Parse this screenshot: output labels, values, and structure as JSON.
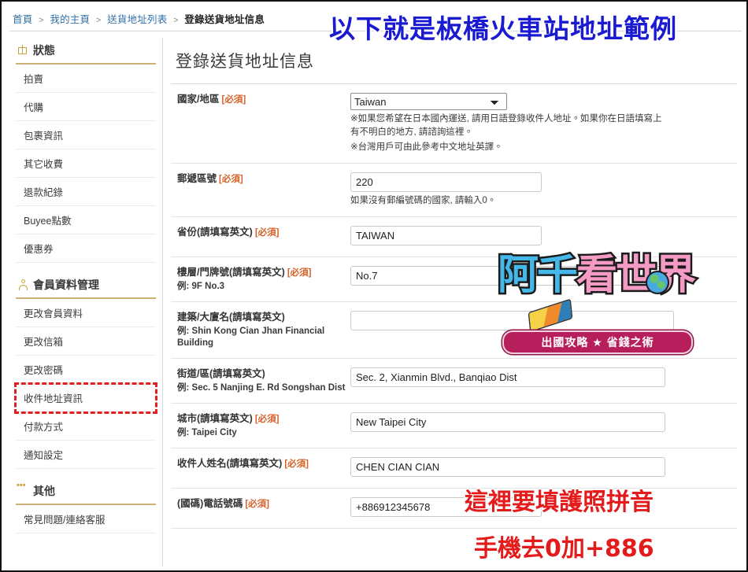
{
  "breadcrumb": {
    "items": [
      "首頁",
      "我的主頁",
      "送貨地址列表"
    ],
    "separator": ">",
    "current": "登錄送貨地址信息"
  },
  "sidebar": {
    "sections": [
      {
        "title": "狀態",
        "icon": "package-icon",
        "items": [
          "拍賣",
          "代購",
          "包裹資訊",
          "其它收費",
          "退款紀錄",
          "Buyee點數",
          "優惠券"
        ]
      },
      {
        "title": "會員資料管理",
        "icon": "person-icon",
        "items": [
          "更改會員資料",
          "更改信箱",
          "更改密碼",
          "收件地址資訊",
          "付款方式",
          "通知設定"
        ],
        "highlighted": "收件地址資訊"
      },
      {
        "title": "其他",
        "icon": "dots-icon",
        "items": [
          "常見問題/連絡客服"
        ]
      }
    ]
  },
  "main": {
    "page_title": "登錄送貨地址信息",
    "required_tag": "[必須]",
    "fields": [
      {
        "label": "國家/地區",
        "required": true,
        "type": "select",
        "value": "Taiwan",
        "options": [
          "Taiwan"
        ],
        "notes": [
          "※如果您希望在日本國內運送, 請用日語登錄收件人地址。如果你在日語填寫上有不明白的地方, 請諮詢這裡。",
          "※台灣用戶可由此參考中文地址英譯。"
        ],
        "note_links": [
          "這裡",
          "中文地址英譯"
        ]
      },
      {
        "label": "郵遞區號",
        "required": true,
        "type": "text",
        "value": "220",
        "placeholder": "",
        "note": "如果沒有郵編號碼的國家, 請輸入0。"
      },
      {
        "label": "省份(請填寫英文)",
        "required": true,
        "type": "text",
        "value": "TAIWAN",
        "placeholder": ""
      },
      {
        "label": "樓層/門牌號(請填寫英文)",
        "required": true,
        "type": "text",
        "example": "例: 9F No.3",
        "value": "No.7",
        "placeholder": ""
      },
      {
        "label": "建築/大廈名(請填寫英文)",
        "required": false,
        "type": "text",
        "example": "例: Shin Kong Cian Jhan Financial Building",
        "value": "",
        "placeholder": ""
      },
      {
        "label": "街道/區(請填寫英文)",
        "required": false,
        "type": "text",
        "example": "例: Sec. 5 Nanjing E. Rd Songshan Dist",
        "value": "Sec. 2, Xianmin Blvd., Banqiao Dist",
        "placeholder": ""
      },
      {
        "label": "城市(請填寫英文)",
        "required": true,
        "type": "text",
        "example": "例: Taipei City",
        "value": "New Taipei City",
        "placeholder": ""
      },
      {
        "label": "收件人姓名(請填寫英文)",
        "required": true,
        "type": "text",
        "value": "CHEN CIAN CIAN",
        "placeholder": ""
      },
      {
        "label": "(國碼)電話號碼",
        "required": true,
        "type": "text",
        "value": "+886912345678",
        "placeholder": ""
      }
    ]
  },
  "annotations": {
    "top_blue": "以下就是板橋火車站地址範例",
    "red_1": "這裡要填護照拼音",
    "red_2": "手機去0加+886",
    "colors": {
      "blue": "#1a1ad0",
      "red": "#e41b1b",
      "highlight_box": "#e02020",
      "required": "#d4622a",
      "section_rule": "#cbb173",
      "link": "#3d7fbf"
    }
  },
  "watermark": {
    "title_part1": "阿千",
    "title_part2": "看世界",
    "subtitle": "出國攻略 ★ 省錢之術"
  }
}
